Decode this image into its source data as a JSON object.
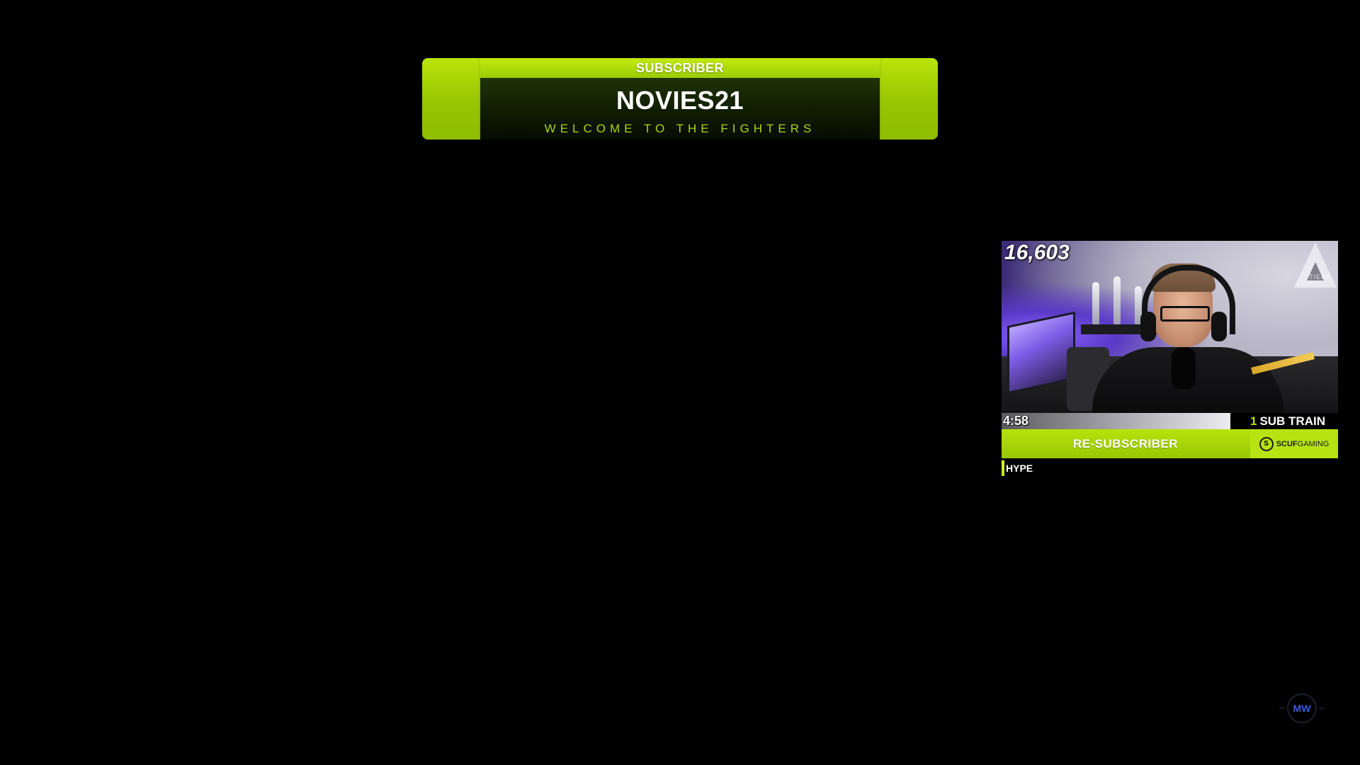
{
  "alert": {
    "tag": "SUBSCRIBER",
    "name": "NOVIES21",
    "message": "WELCOME TO THE FIGHTERS"
  },
  "webcam": {
    "viewer_count": "16,603",
    "logo_text": "TIEEP"
  },
  "sub_train": {
    "timer": "4:58",
    "count": "1",
    "label": "SUB TRAIN",
    "progress_fraction": 0.68
  },
  "resub": {
    "label": "RE-SUBSCRIBER",
    "sponsor_brand": "SCUF",
    "sponsor_suffix": "GAMING"
  },
  "hype": {
    "label": "HYPE",
    "level_fraction": 0.01
  },
  "watermark": {
    "text": "MW"
  },
  "colors": {
    "accent": "#a6d30a",
    "accent_dark": "#0f1a02",
    "text_accent": "#a9d416",
    "background": "#000000"
  }
}
